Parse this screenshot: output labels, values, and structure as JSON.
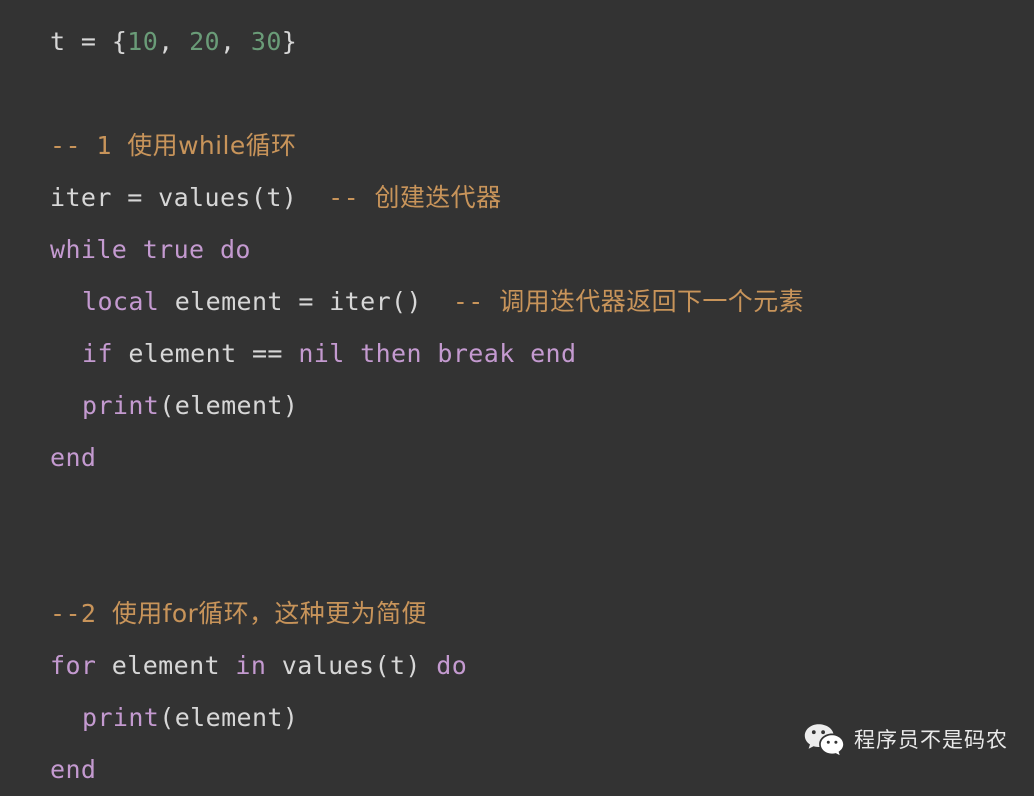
{
  "theme": {
    "background": "#333333",
    "plain": "#d7d7d7",
    "keyword": "#c49ad0",
    "number": "#6a9c78",
    "comment": "#c8945a",
    "watermark_text": "#e9e9e9"
  },
  "code": {
    "language": "lua",
    "lines": [
      {
        "id": "line-1",
        "indent": 0,
        "tokens": [
          {
            "t": "plain",
            "v": "t = "
          },
          {
            "t": "punct",
            "v": "{"
          },
          {
            "t": "number",
            "v": "10"
          },
          {
            "t": "punct",
            "v": ", "
          },
          {
            "t": "number",
            "v": "20"
          },
          {
            "t": "punct",
            "v": ", "
          },
          {
            "t": "number",
            "v": "30"
          },
          {
            "t": "punct",
            "v": "}"
          }
        ]
      },
      {
        "id": "line-2",
        "blank": true,
        "tokens": []
      },
      {
        "id": "line-3",
        "indent": 0,
        "tokens": [
          {
            "t": "comment",
            "v": "-- 1 "
          },
          {
            "t": "comment",
            "v": "使用while循环",
            "cjk": true
          }
        ]
      },
      {
        "id": "line-4",
        "indent": 0,
        "tokens": [
          {
            "t": "plain",
            "v": "iter = values(t)  "
          },
          {
            "t": "comment",
            "v": "-- "
          },
          {
            "t": "comment",
            "v": "创建迭代器",
            "cjk": true
          }
        ]
      },
      {
        "id": "line-5",
        "indent": 0,
        "tokens": [
          {
            "t": "keyword",
            "v": "while true do"
          }
        ]
      },
      {
        "id": "line-6",
        "indent": 1,
        "tokens": [
          {
            "t": "keyword",
            "v": "local"
          },
          {
            "t": "plain",
            "v": " element = iter()  "
          },
          {
            "t": "comment",
            "v": "-- "
          },
          {
            "t": "comment",
            "v": "调用迭代器返回下一个元素",
            "cjk": true
          }
        ]
      },
      {
        "id": "line-7",
        "indent": 1,
        "tokens": [
          {
            "t": "keyword",
            "v": "if"
          },
          {
            "t": "plain",
            "v": " element == "
          },
          {
            "t": "keyword",
            "v": "nil then break end"
          }
        ]
      },
      {
        "id": "line-8",
        "indent": 1,
        "tokens": [
          {
            "t": "keyword",
            "v": "print"
          },
          {
            "t": "plain",
            "v": "(element)"
          }
        ]
      },
      {
        "id": "line-9",
        "indent": 0,
        "tokens": [
          {
            "t": "keyword",
            "v": "end"
          }
        ]
      },
      {
        "id": "line-10",
        "blank": true,
        "tokens": []
      },
      {
        "id": "line-11",
        "blank": true,
        "tokens": []
      },
      {
        "id": "line-12",
        "indent": 0,
        "tokens": [
          {
            "t": "comment",
            "v": "--2 "
          },
          {
            "t": "comment",
            "v": "使用for循环，这种更为简便",
            "cjk": true
          }
        ]
      },
      {
        "id": "line-13",
        "indent": 0,
        "tokens": [
          {
            "t": "keyword",
            "v": "for"
          },
          {
            "t": "plain",
            "v": " element "
          },
          {
            "t": "keyword",
            "v": "in"
          },
          {
            "t": "plain",
            "v": " values(t) "
          },
          {
            "t": "keyword",
            "v": "do"
          }
        ]
      },
      {
        "id": "line-14",
        "indent": 1,
        "tokens": [
          {
            "t": "keyword",
            "v": "print"
          },
          {
            "t": "plain",
            "v": "(element)"
          }
        ]
      },
      {
        "id": "line-15",
        "indent": 0,
        "tokens": [
          {
            "t": "keyword",
            "v": "end"
          }
        ]
      }
    ]
  },
  "watermark": {
    "icon": "wechat-logo-icon",
    "label": "程序员不是码农"
  }
}
